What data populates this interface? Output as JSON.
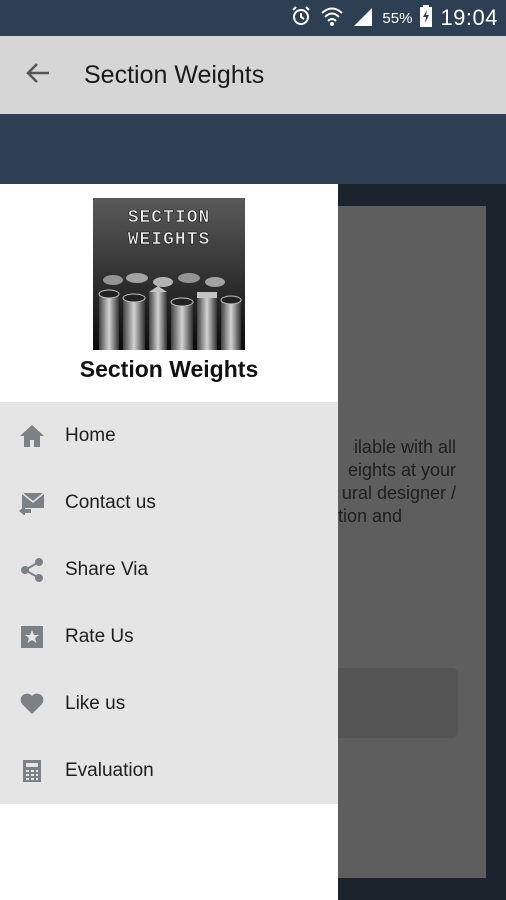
{
  "status_bar": {
    "battery": "55%",
    "time": "19:04"
  },
  "app_bar": {
    "title": "Section Weights"
  },
  "drawer": {
    "logo_line1": "SECTION",
    "logo_line2": "WEIGHTS",
    "title": "Section Weights",
    "items": [
      {
        "label": "Home",
        "icon": "home-icon"
      },
      {
        "label": "Contact us",
        "icon": "mail-reply-icon"
      },
      {
        "label": "Share Via",
        "icon": "share-icon"
      },
      {
        "label": "Rate Us",
        "icon": "star-icon"
      },
      {
        "label": "Like us",
        "icon": "heart-icon"
      },
      {
        "label": "Evaluation",
        "icon": "calculator-icon"
      }
    ]
  },
  "background": {
    "lines": [
      "ilable with all",
      "eights at your",
      "ural designer /",
      "ction and"
    ]
  },
  "colors": {
    "status_bar": "#2d3f52",
    "app_bar": "#d6d6d6",
    "drawer_menu": "#e5e5e5",
    "icon": "#7c8087"
  }
}
